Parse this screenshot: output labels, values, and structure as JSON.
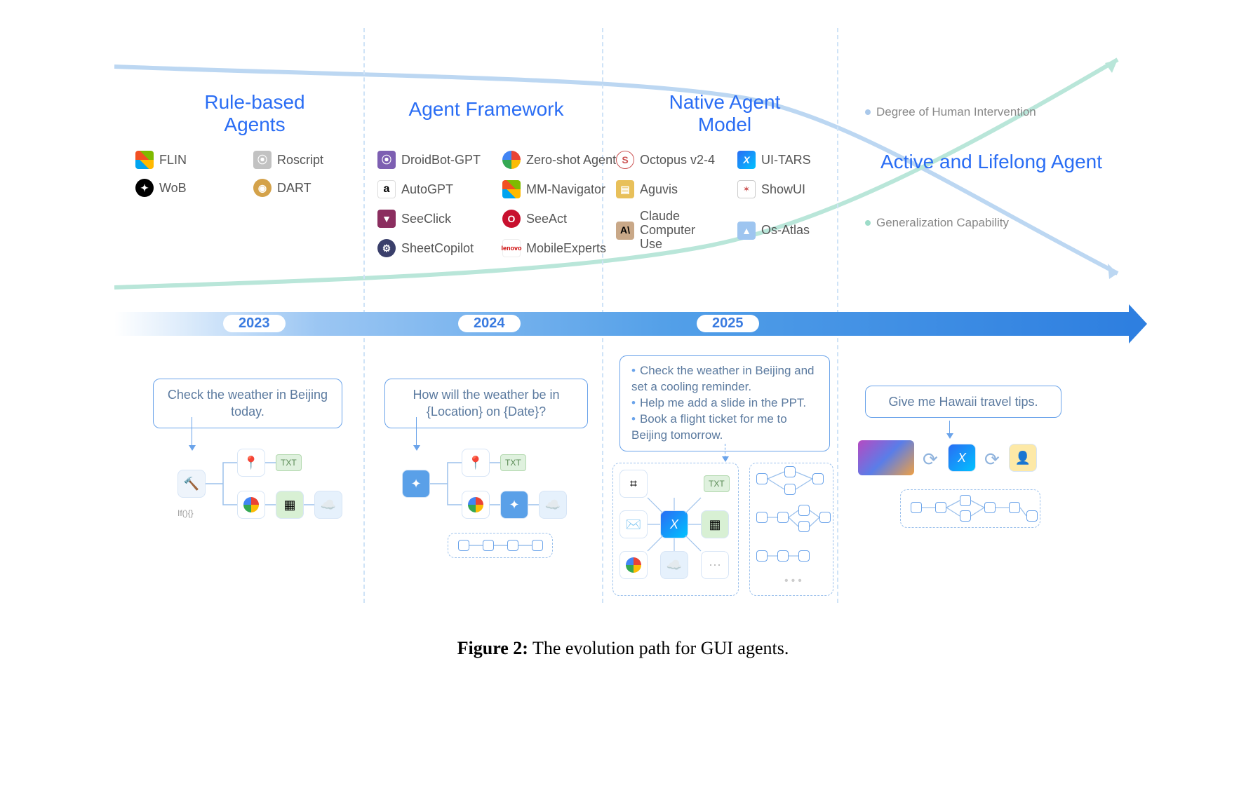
{
  "figure": {
    "label": "Figure 2:",
    "caption": "The evolution path for GUI agents."
  },
  "columns": {
    "c1": {
      "title": "Rule-based\nAgents",
      "year": "2023",
      "agents": [
        "FLIN",
        "Roscript",
        "WoB",
        "DART"
      ],
      "prompt": "Check the weather in Beijing today."
    },
    "c2": {
      "title": "Agent Framework",
      "year": "2024",
      "agents": [
        "DroidBot-GPT",
        "Zero-shot Agent",
        "AutoGPT",
        "MM-Navigator",
        "SeeClick",
        "SeeAct",
        "SheetCopilot",
        "MobileExperts"
      ],
      "prompt": "How will the weather be in {Location} on {Date}?"
    },
    "c3": {
      "title": "Native Agent\nModel",
      "year": "2025",
      "agents": [
        "Octopus v2-4",
        "UI-TARS",
        "Aguvis",
        "ShowUI",
        "Claude Computer Use",
        "Os-Atlas"
      ],
      "prompt_lines": [
        "Check the weather in Beijing and set a cooling reminder.",
        "Help me add a slide in the PPT.",
        "Book a flight ticket for me to Beijing tomorrow."
      ]
    },
    "c4": {
      "title": "Active and Lifelong Agent",
      "prompt": "Give me Hawaii travel tips.",
      "legend1": "Degree of Human Intervention",
      "legend2": "Generalization Capability"
    }
  },
  "icons": {
    "flin": "microsoft",
    "roscript": "seal",
    "wob": "openai",
    "dart": "univ",
    "droidbot": "seal",
    "zeroshot": "chrome",
    "autogpt": "amazon",
    "mmnav": "microsoft",
    "seeclick": "shield",
    "seeact": "ohio",
    "sheetcopilot": "gear",
    "mobileexperts": "lenovo",
    "octopus": "stanford",
    "uitars": "x",
    "aguvis": "hku",
    "showui": "nus",
    "claude": "anthropic",
    "osatlas": "mountain"
  },
  "misc": {
    "if_label": "If(){}"
  }
}
